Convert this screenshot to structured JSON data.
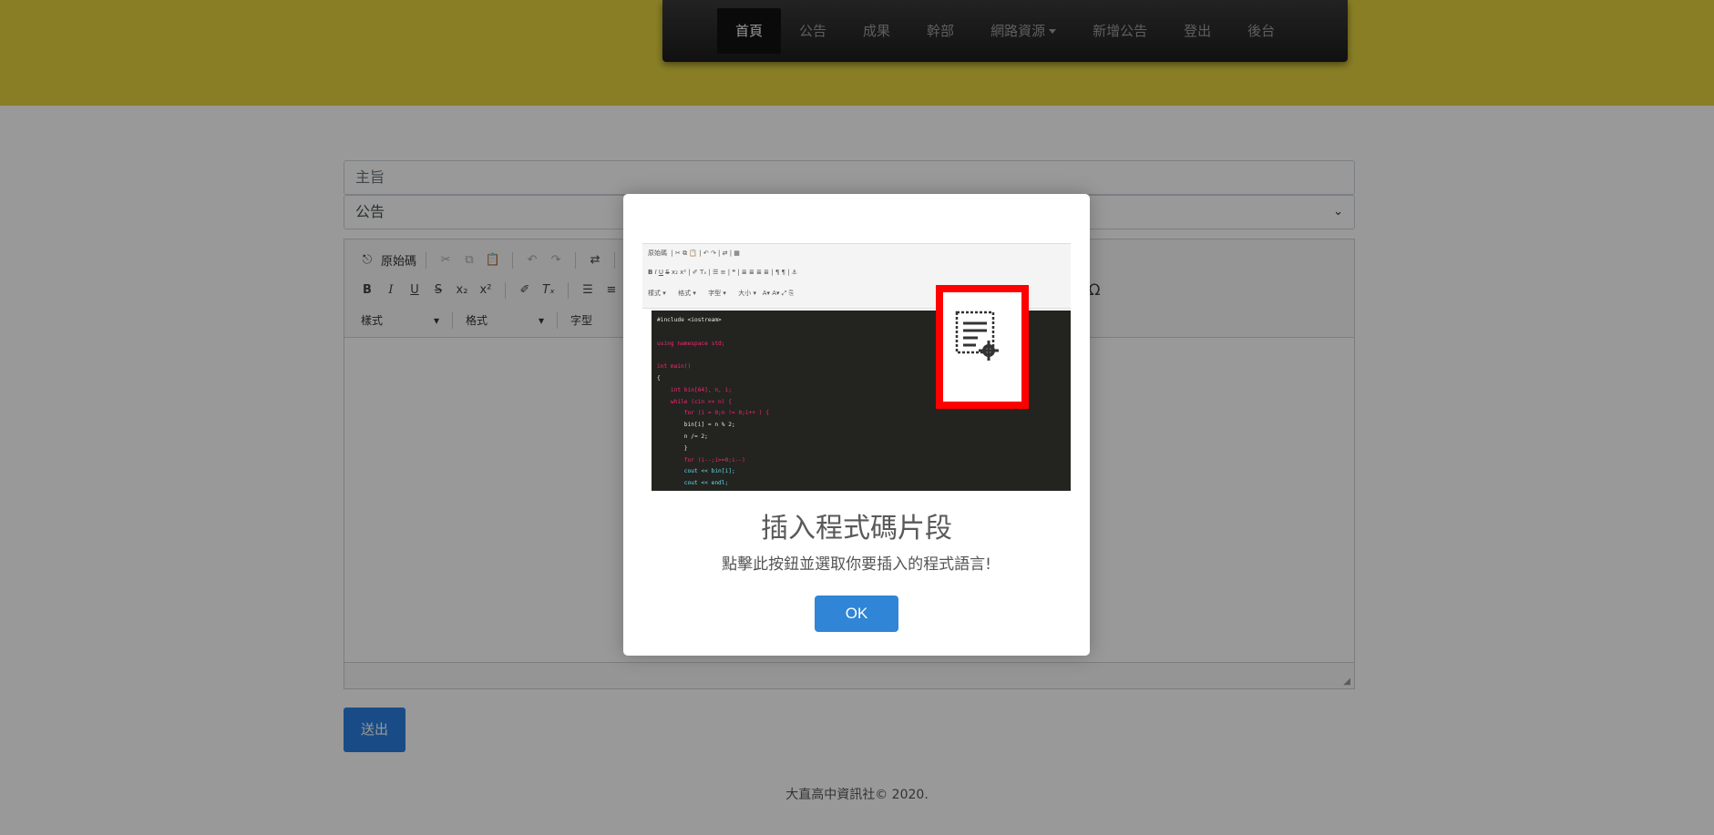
{
  "nav": {
    "items": [
      {
        "label": "首頁"
      },
      {
        "label": "公告"
      },
      {
        "label": "成果"
      },
      {
        "label": "幹部"
      },
      {
        "label": "網路資源"
      },
      {
        "label": "新增公告"
      },
      {
        "label": "登出"
      },
      {
        "label": "後台"
      }
    ]
  },
  "form": {
    "subject_placeholder": "主旨",
    "category_value": "公告",
    "submit_label": "送出"
  },
  "editor": {
    "source_label": "原始碼",
    "combo_styles": "樣式",
    "combo_format": "格式",
    "combo_font": "字型",
    "omega_glyph": "Ω"
  },
  "footer": {
    "text": "大直高中資訊社© 2020."
  },
  "modal": {
    "title": "插入程式碼片段",
    "text": "點擊此按鈕並選取你要插入的程式語言!",
    "ok_label": "OK",
    "shot": {
      "source_label": "原始碼",
      "combo_styles": "樣式",
      "combo_format": "格式",
      "combo_font": "字型",
      "combo_size": "大小",
      "code_lines": [
        "#include <iostream>",
        "",
        "using namespace std;",
        "",
        "int main()",
        "{",
        "    int bin[64], n, i;",
        "    while (cin >> n) {",
        "        for (i = 0;n != 0;i++ ) {",
        "        bin[i] = n % 2;",
        "        n /= 2;",
        "        }",
        "        for (i--;i>=0;i--)",
        "        cout << bin[i];",
        "        cout << endl;"
      ]
    }
  },
  "colors": {
    "header_band": "#e4d33f",
    "ok_button": "#3085d6",
    "highlight": "#ff0000"
  }
}
